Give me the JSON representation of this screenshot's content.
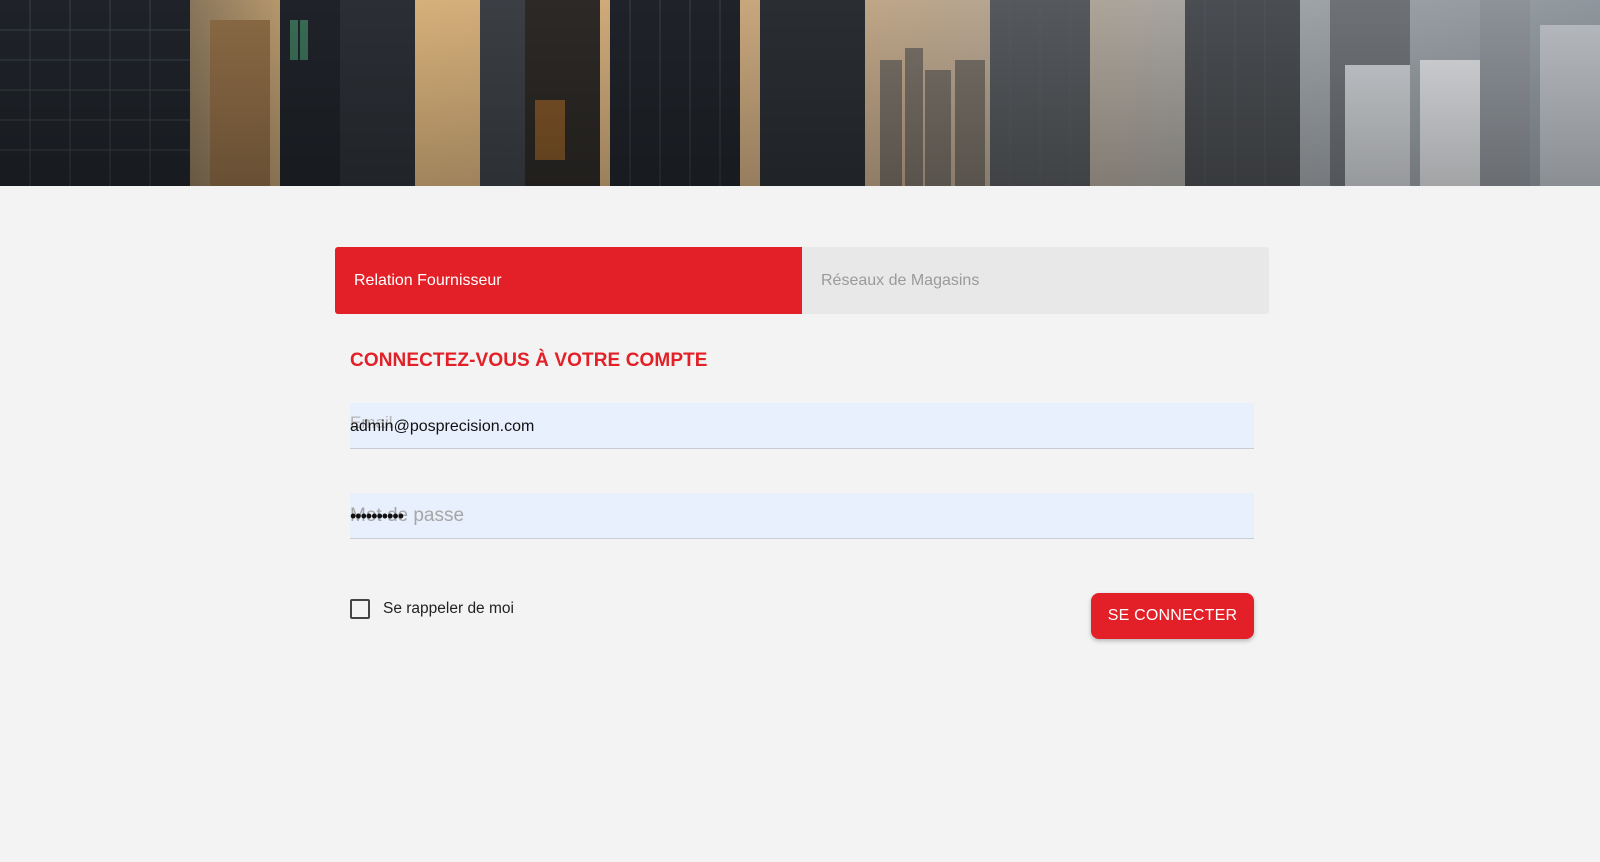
{
  "hero": {
    "image": "city-skyline-sunset"
  },
  "tabs": [
    {
      "label": "Relation Fournisseur",
      "active": true
    },
    {
      "label": "Réseaux de Magasins",
      "active": false
    }
  ],
  "form": {
    "title": "CONNECTEZ-VOUS À VOTRE COMPTE",
    "email": {
      "label": "Email",
      "value": "admin@posprecision.com"
    },
    "password": {
      "label": "Mot de passe",
      "value": "••••••••••"
    },
    "remember": {
      "label": "Se rappeler de moi",
      "checked": false
    },
    "submit_label": "SE CONNECTER"
  },
  "colors": {
    "accent": "#e32027",
    "background": "#f2f3f2",
    "tab_inactive": "#e8e8e8",
    "field_background": "#e8effd"
  }
}
